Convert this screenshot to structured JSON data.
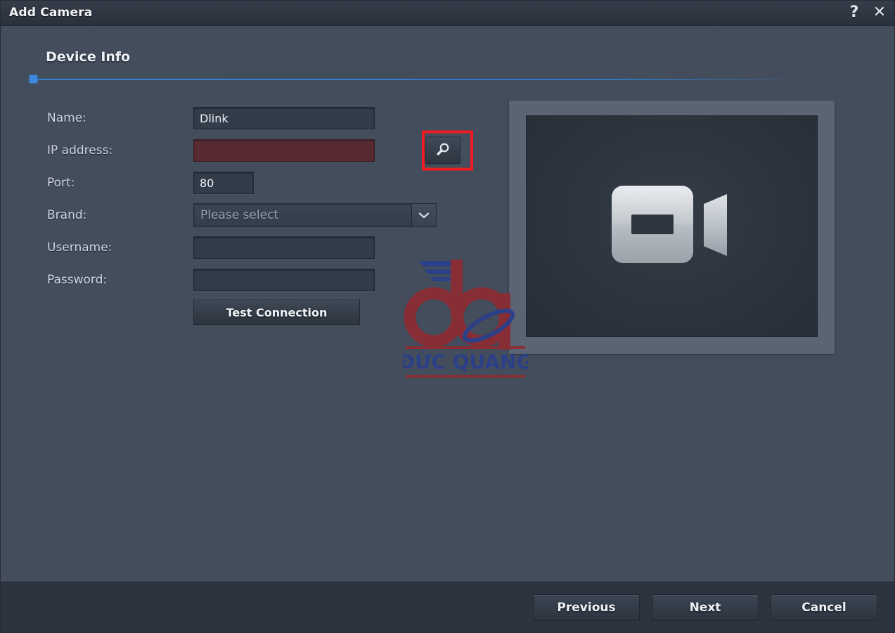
{
  "window": {
    "title": "Add Camera",
    "help_icon": "question-mark-icon",
    "close_icon": "close-icon"
  },
  "step": {
    "title": "Device Info",
    "progress_percent": 0,
    "accent_color": "#2f80d2"
  },
  "form": {
    "fields": [
      {
        "label": "Name:",
        "value": "Dlink",
        "placeholder": "",
        "type": "text",
        "state": "normal"
      },
      {
        "label": "IP address:",
        "value": "",
        "placeholder": "",
        "type": "text",
        "state": "error"
      },
      {
        "label": "Port:",
        "value": "80",
        "placeholder": "",
        "type": "text",
        "state": "normal"
      },
      {
        "label": "Brand:",
        "value": "Please select",
        "placeholder": "",
        "type": "select",
        "state": "normal"
      },
      {
        "label": "Username:",
        "value": "",
        "placeholder": "",
        "type": "text",
        "state": "normal"
      },
      {
        "label": "Password:",
        "value": "",
        "placeholder": "",
        "type": "password",
        "state": "normal"
      }
    ],
    "search_button": {
      "icon": "search-icon",
      "highlighted": true,
      "highlight_color": "#ee1c25"
    },
    "select_arrow_icon": "chevron-down-icon",
    "test_connection_label": "Test Connection"
  },
  "preview": {
    "icon": "video-camera-icon",
    "screen_color": "#2b333d",
    "frame_color": "#5a6472"
  },
  "watermark": {
    "logo_text": "dq",
    "brand_text": "ĐỨC QUANG",
    "primary_color": "#8c2b33",
    "secondary_color": "#2b3f8c"
  },
  "footer": {
    "buttons": [
      {
        "label": "Previous"
      },
      {
        "label": "Next"
      },
      {
        "label": "Cancel"
      }
    ]
  },
  "theme": {
    "background": "#434d5c",
    "titlebar": "#2f3642",
    "footer": "#2d3440",
    "field_background": "#333c49",
    "error_field_background": "#5a2a32",
    "text": "#eef2f7"
  }
}
